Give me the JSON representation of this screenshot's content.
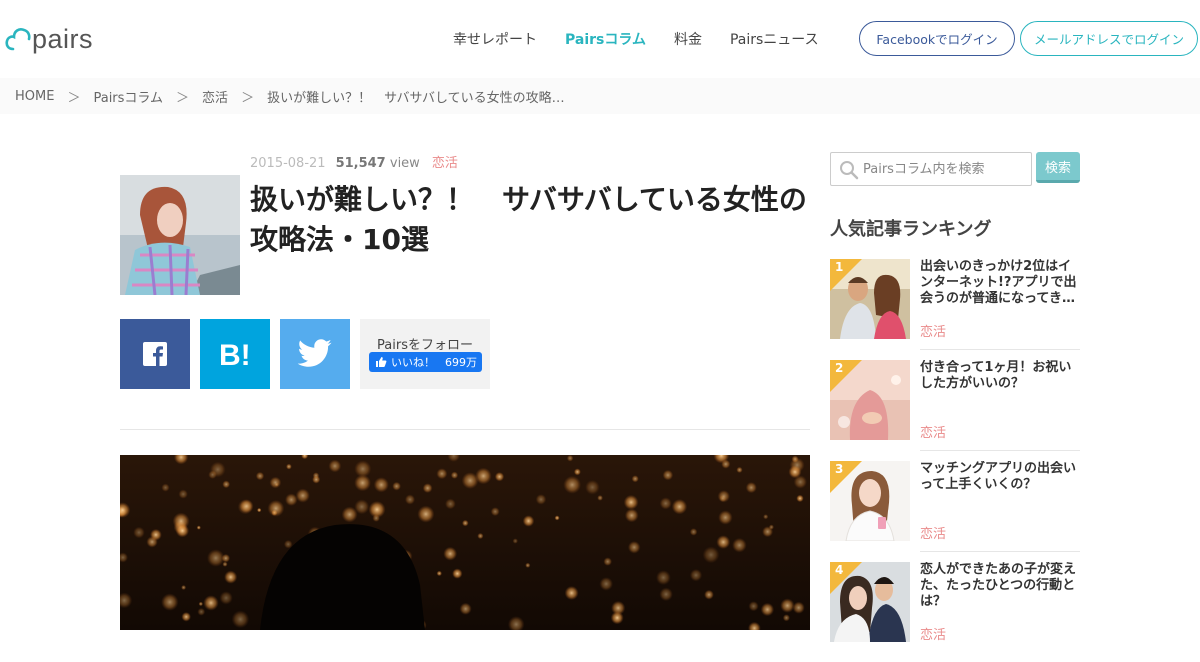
{
  "header": {
    "logo_text": "pairs",
    "nav": [
      {
        "label": "幸せレポート",
        "active": false
      },
      {
        "label": "Pairsコラム",
        "active": true
      },
      {
        "label": "料金",
        "active": false
      },
      {
        "label": "Pairsニュース",
        "active": false
      }
    ],
    "facebook_login": "Facebookでログイン",
    "mail_login": "メールアドレスでログイン"
  },
  "breadcrumb": {
    "items": [
      "HOME",
      "Pairsコラム",
      "恋活",
      "扱いが難しい？！　サバサバしている女性の攻略…"
    ],
    "separator": "＞"
  },
  "article": {
    "date": "2015-08-21",
    "views": "51,547",
    "views_unit": "view",
    "category": "恋活",
    "title": "扱いが難しい？！　サバサバしている女性の攻略法・10選"
  },
  "share": {
    "follow_label": "Pairsをフォロー",
    "like_label": "いいね！",
    "like_count": "699万"
  },
  "sidebar": {
    "search_placeholder": "Pairsコラム内を検索",
    "search_button": "検索",
    "ranking_heading": "人気記事ランキング",
    "ranking": [
      {
        "rank": "1",
        "title": "出会いのきっかけ2位はインターネット!?アプリで出会うのが普通になってき…",
        "category": "恋活"
      },
      {
        "rank": "2",
        "title": "付き合って1ヶ月！お祝いした方がいいの？",
        "category": "恋活"
      },
      {
        "rank": "3",
        "title": "マッチングアプリの出会いって上手くいくの？",
        "category": "恋活"
      },
      {
        "rank": "4",
        "title": "恋人ができたあの子が変えた、たったひとつの行動とは？",
        "category": "恋活"
      }
    ]
  },
  "colors": {
    "brand_teal": "#2ab5bf",
    "facebook": "#3b5a9a",
    "hatena": "#00a4de",
    "twitter": "#55acee",
    "category_pink": "#e98a8a",
    "rank_badge": "#f3b83c"
  }
}
